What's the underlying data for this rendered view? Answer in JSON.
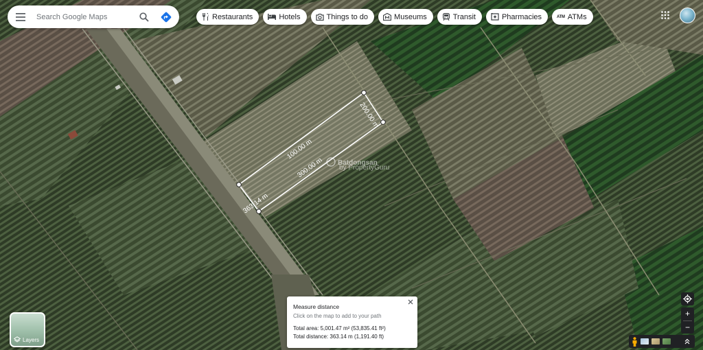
{
  "search": {
    "placeholder": "Search Google Maps"
  },
  "chips": [
    {
      "label": "Restaurants",
      "icon": "restaurant-icon"
    },
    {
      "label": "Hotels",
      "icon": "hotel-icon"
    },
    {
      "label": "Things to do",
      "icon": "camera-icon"
    },
    {
      "label": "Museums",
      "icon": "museum-icon"
    },
    {
      "label": "Transit",
      "icon": "transit-icon"
    },
    {
      "label": "Pharmacies",
      "icon": "pharmacy-icon"
    },
    {
      "label": "ATMs",
      "icon": "atm-icon",
      "icon_text": "ATM"
    }
  ],
  "measure_labels": {
    "side_top": "200.00 m",
    "side_long_upper": "100.00 m",
    "side_long_lower": "300.00 m",
    "side_bottom": "363.14 m"
  },
  "watermark": {
    "text": "Batdongsan",
    "subtext": "by PropertyGuru"
  },
  "layers": {
    "label": "Layers"
  },
  "measure_card": {
    "title": "Measure distance",
    "hint": "Click on the map to add to your path",
    "total_area": "Total area: 5,001.47 m² (53,835.41 ft²)",
    "total_distance": "Total distance: 363.14 m (1,191.40 ft)"
  },
  "controls": {
    "zoom_in": "+",
    "zoom_out": "−"
  },
  "colors": {
    "brand_blue": "#1a73e8",
    "directions_green": "#0f9d58",
    "dark_control": "#202124"
  }
}
